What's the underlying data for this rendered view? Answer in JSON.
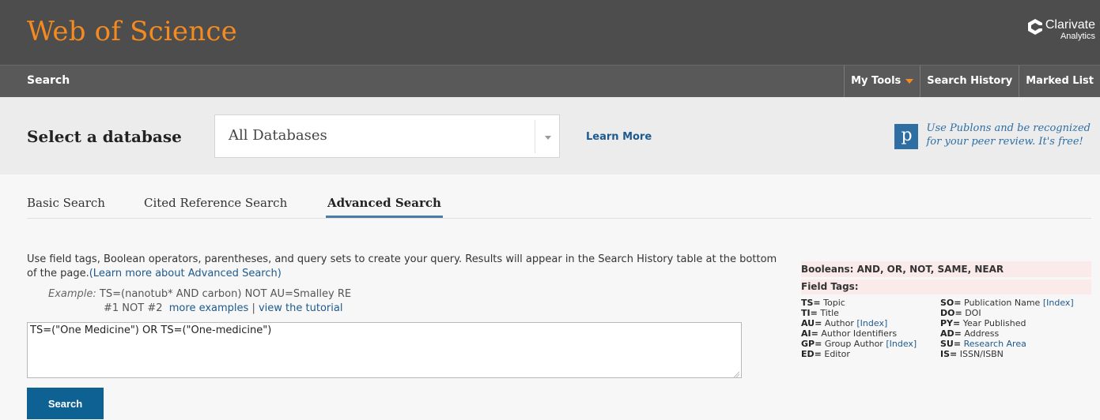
{
  "header": {
    "app_title": "Web of Science",
    "brand": "Clarivate",
    "brand_sub": "Analytics"
  },
  "nav": {
    "search": "Search",
    "my_tools": "My Tools",
    "search_history": "Search History",
    "marked_list": "Marked List",
    "accent_color": "#f58a1f"
  },
  "database": {
    "label": "Select a database",
    "selected": "All Databases",
    "learn_more": "Learn More"
  },
  "publons": {
    "icon_letter": "p",
    "line1": "Use Publons and be recognized",
    "line2": "for your peer review. It's free!"
  },
  "tabs": [
    {
      "label": "Basic Search",
      "active": false
    },
    {
      "label": "Cited Reference Search",
      "active": false
    },
    {
      "label": "Advanced Search",
      "active": true
    }
  ],
  "instructions": {
    "text": "Use field tags, Boolean operators, parentheses, and query sets to create your query. Results will appear in the Search History table at the bottom of the page.",
    "link": "(Learn more about Advanced Search)",
    "example_label": "Example:",
    "example_query": "TS=(nanotub* AND carbon) NOT AU=Smalley RE",
    "example_sets": "#1 NOT #2",
    "more_examples": "more examples",
    "separator": "|",
    "view_tutorial": "view the tutorial"
  },
  "query": {
    "value": "TS=(\"One Medicine\") OR TS=(\"One-medicine\")"
  },
  "search_button": "Search",
  "reference": {
    "booleans": "Booleans: AND, OR, NOT, SAME, NEAR",
    "field_tags_heading": "Field Tags:",
    "left": [
      {
        "tag": "TS=",
        "desc": "Topic",
        "index": ""
      },
      {
        "tag": "TI=",
        "desc": "Title",
        "index": ""
      },
      {
        "tag": "AU=",
        "desc": "Author",
        "index": "[Index]"
      },
      {
        "tag": "AI=",
        "desc": "Author Identifiers",
        "index": ""
      },
      {
        "tag": "GP=",
        "desc": "Group Author",
        "index": "[Index]"
      },
      {
        "tag": "ED=",
        "desc": "Editor",
        "index": ""
      }
    ],
    "right": [
      {
        "tag": "SO=",
        "desc": "Publication Name",
        "index": "[Index]",
        "link_desc": false
      },
      {
        "tag": "DO=",
        "desc": "DOI",
        "index": "",
        "link_desc": false
      },
      {
        "tag": "PY=",
        "desc": "Year Published",
        "index": "",
        "link_desc": false
      },
      {
        "tag": "AD=",
        "desc": "Address",
        "index": "",
        "link_desc": false
      },
      {
        "tag": "SU=",
        "desc": "Research Area",
        "index": "",
        "link_desc": true
      },
      {
        "tag": "IS=",
        "desc": "ISSN/ISBN",
        "index": "",
        "link_desc": false
      }
    ]
  }
}
